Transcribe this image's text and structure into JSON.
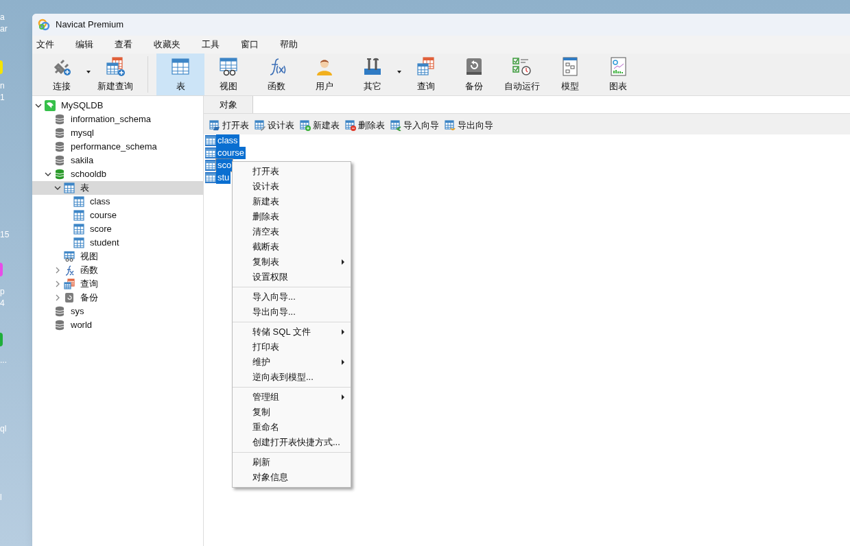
{
  "desktop": {
    "labels": [
      {
        "text": "a"
      },
      {
        "text": "ar"
      },
      {
        "text": "n"
      },
      {
        "text": "1"
      },
      {
        "text": "15"
      },
      {
        "text": "p"
      },
      {
        "text": "4"
      },
      {
        "text": "..."
      },
      {
        "text": "ql"
      },
      {
        "text": "l"
      }
    ],
    "icons": [
      {
        "color": "#f5e400"
      },
      {
        "color": "#e84ce8"
      },
      {
        "color": "#1fae3a"
      }
    ]
  },
  "window": {
    "title": "Navicat Premium"
  },
  "menu_bar": [
    "文件",
    "编辑",
    "查看",
    "收藏夹",
    "工具",
    "窗口",
    "帮助"
  ],
  "toolbar": [
    {
      "label": "连接",
      "kind": "connect",
      "selected": false,
      "dropdown": true
    },
    {
      "label": "新建查询",
      "kind": "new-query",
      "selected": false,
      "dropdown": false
    },
    {
      "label": "表",
      "kind": "table",
      "selected": true,
      "dropdown": false
    },
    {
      "label": "视图",
      "kind": "view",
      "selected": false,
      "dropdown": false
    },
    {
      "label": "函数",
      "kind": "function",
      "selected": false,
      "dropdown": false
    },
    {
      "label": "用户",
      "kind": "user",
      "selected": false,
      "dropdown": false
    },
    {
      "label": "其它",
      "kind": "tools",
      "selected": false,
      "dropdown": true
    },
    {
      "label": "查询",
      "kind": "query",
      "selected": false,
      "dropdown": false
    },
    {
      "label": "备份",
      "kind": "backup",
      "selected": false,
      "dropdown": false
    },
    {
      "label": "自动运行",
      "kind": "schedule",
      "selected": false,
      "dropdown": false
    },
    {
      "label": "模型",
      "kind": "model",
      "selected": false,
      "dropdown": false
    },
    {
      "label": "图表",
      "kind": "chart",
      "selected": false,
      "dropdown": false
    }
  ],
  "tree": [
    {
      "label": "MySQLDB",
      "kind": "connection",
      "expanded": true,
      "selected": false,
      "children": [
        {
          "label": "information_schema",
          "kind": "database",
          "selected": false
        },
        {
          "label": "mysql",
          "kind": "database",
          "selected": false
        },
        {
          "label": "performance_schema",
          "kind": "database",
          "selected": false
        },
        {
          "label": "sakila",
          "kind": "database",
          "selected": false
        },
        {
          "label": "schooldb",
          "kind": "database-open",
          "expanded": true,
          "selected": false,
          "children": [
            {
              "label": "表",
              "kind": "tables",
              "expanded": true,
              "selected": true,
              "children": [
                {
                  "label": "class",
                  "kind": "table",
                  "selected": false
                },
                {
                  "label": "course",
                  "kind": "table",
                  "selected": false
                },
                {
                  "label": "score",
                  "kind": "table",
                  "selected": false
                },
                {
                  "label": "student",
                  "kind": "table",
                  "selected": false
                }
              ]
            },
            {
              "label": "视图",
              "kind": "views",
              "selected": false
            },
            {
              "label": "函数",
              "kind": "functions",
              "expanded": false,
              "selected": false
            },
            {
              "label": "查询",
              "kind": "queries",
              "expanded": false,
              "selected": false
            },
            {
              "label": "备份",
              "kind": "backups",
              "expanded": false,
              "selected": false
            }
          ]
        },
        {
          "label": "sys",
          "kind": "database",
          "selected": false
        },
        {
          "label": "world",
          "kind": "database",
          "selected": false
        }
      ]
    }
  ],
  "tabs": [
    {
      "label": "对象",
      "selected": true
    }
  ],
  "object_toolbar": [
    {
      "label": "打开表",
      "kind": "open"
    },
    {
      "label": "设计表",
      "kind": "design"
    },
    {
      "label": "新建表",
      "kind": "new"
    },
    {
      "label": "删除表",
      "kind": "delete"
    },
    {
      "label": "导入向导",
      "kind": "import"
    },
    {
      "label": "导出向导",
      "kind": "export"
    }
  ],
  "objects": [
    {
      "name": "class",
      "selected": true,
      "focused": false
    },
    {
      "name": "course",
      "selected": true,
      "focused": false
    },
    {
      "name": "sco",
      "selected": true,
      "focused": true
    },
    {
      "name": "stu",
      "selected": true,
      "focused": false
    }
  ],
  "context_menu": [
    [
      {
        "label": "打开表",
        "submenu": false
      },
      {
        "label": "设计表",
        "submenu": false
      },
      {
        "label": "新建表",
        "submenu": false
      },
      {
        "label": "删除表",
        "submenu": false
      },
      {
        "label": "清空表",
        "submenu": false
      },
      {
        "label": "截断表",
        "submenu": false
      },
      {
        "label": "复制表",
        "submenu": true
      },
      {
        "label": "设置权限",
        "submenu": false
      }
    ],
    [
      {
        "label": "导入向导...",
        "submenu": false
      },
      {
        "label": "导出向导...",
        "submenu": false
      }
    ],
    [
      {
        "label": "转储 SQL 文件",
        "submenu": true
      },
      {
        "label": "打印表",
        "submenu": false
      },
      {
        "label": "维护",
        "submenu": true
      },
      {
        "label": "逆向表到模型...",
        "submenu": false
      }
    ],
    [
      {
        "label": "管理组",
        "submenu": true
      },
      {
        "label": "复制",
        "submenu": false
      },
      {
        "label": "重命名",
        "submenu": false
      },
      {
        "label": "创建打开表快捷方式...",
        "submenu": false
      }
    ],
    [
      {
        "label": "刷新",
        "submenu": false
      },
      {
        "label": "对象信息",
        "submenu": false
      }
    ]
  ]
}
